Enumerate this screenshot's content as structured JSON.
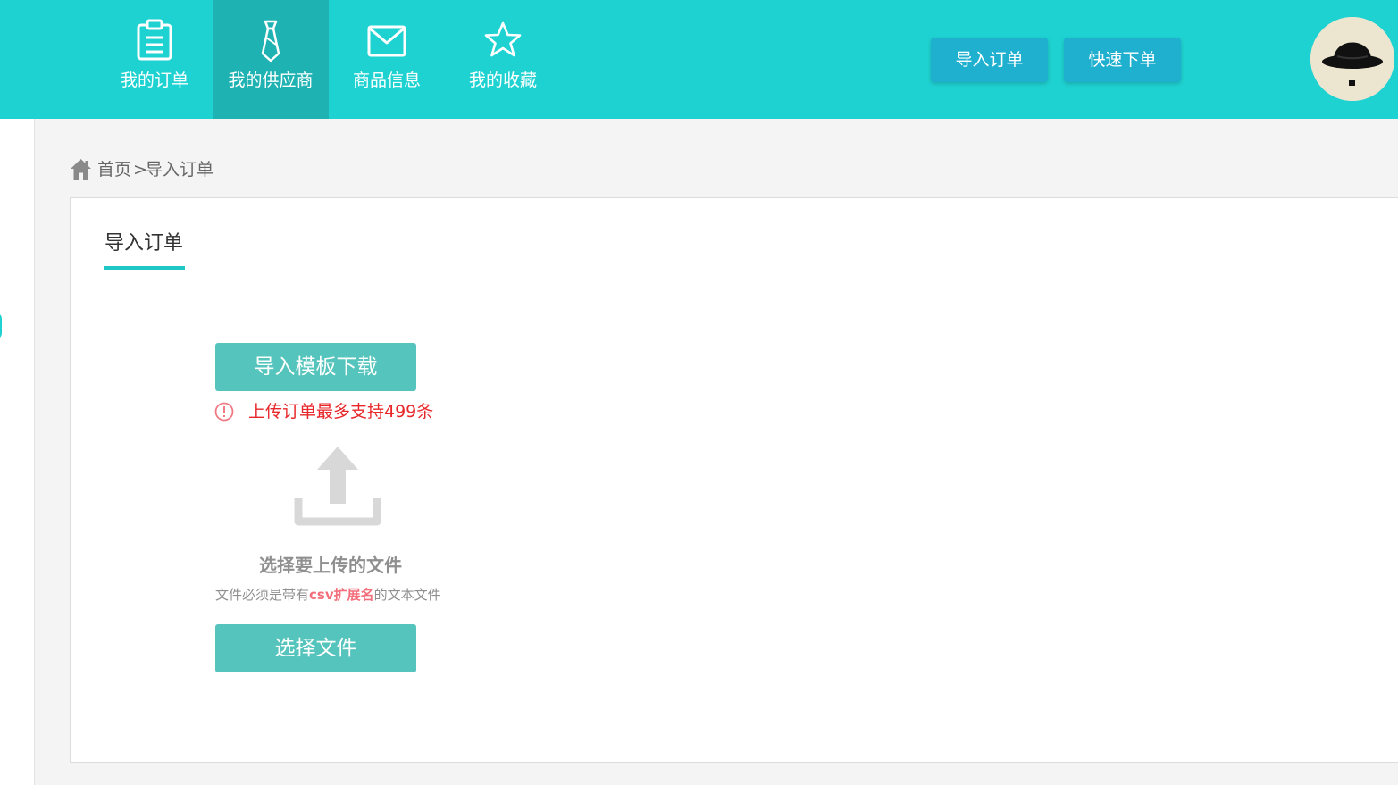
{
  "nav": {
    "items": [
      {
        "label": "我的订单",
        "icon": "clipboard-icon",
        "active": false
      },
      {
        "label": "我的供应商",
        "icon": "tie-icon",
        "active": true
      },
      {
        "label": "商品信息",
        "icon": "envelope-icon",
        "active": false
      },
      {
        "label": "我的收藏",
        "icon": "star-icon",
        "active": false
      }
    ]
  },
  "header": {
    "import_order_label": "导入订单",
    "quick_order_label": "快速下单",
    "avatar_icon": "bowler-hat-avatar"
  },
  "breadcrumb": {
    "home_label": "首页",
    "separator": ">",
    "current_label": "导入订单"
  },
  "panel": {
    "tab_title": "导入订单",
    "template_download_label": "导入模板下载",
    "notice": "上传订单最多支持499条",
    "upload_title": "选择要上传的文件",
    "hint_prefix": "文件必须是带有",
    "hint_highlight": "csv扩展名",
    "hint_suffix": "的文本文件",
    "choose_file_label": "选择文件"
  },
  "colors": {
    "header_bg": "#1fd2d2",
    "nav_active_bg": "#1fb2b2",
    "header_button_bg": "#1fb0cf",
    "primary_button_bg": "#55c4bc",
    "notice_red": "#e8272a",
    "hint_highlight": "#f36f7c"
  }
}
